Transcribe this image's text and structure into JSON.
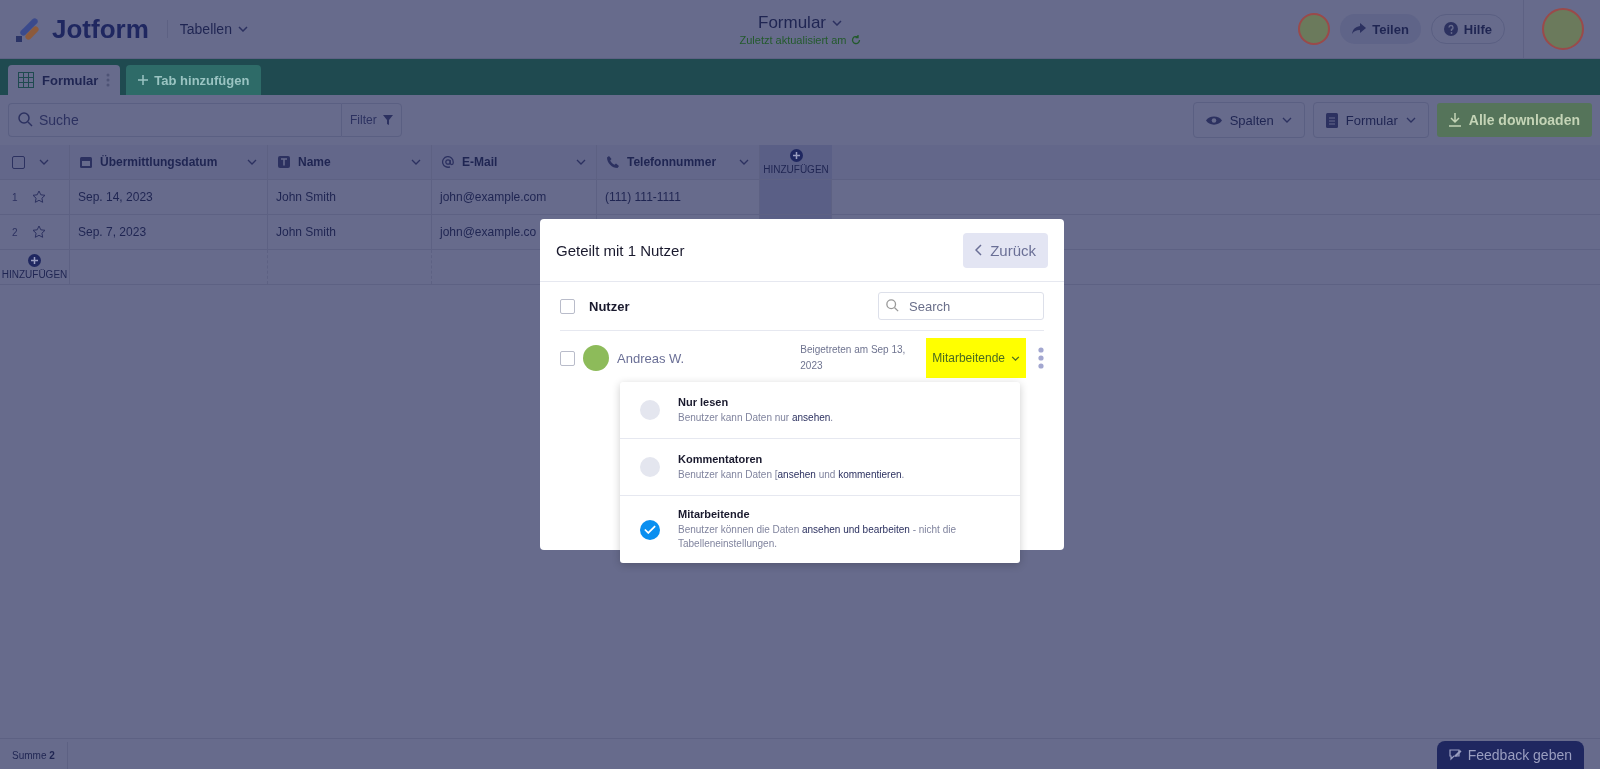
{
  "header": {
    "logo": "Jotform",
    "section": "Tabellen",
    "title": "Formular",
    "subtitle": "Zuletzt aktualisiert am",
    "share": "Teilen",
    "help": "Hilfe"
  },
  "tabs": [
    {
      "label": "Formular",
      "selected": true
    }
  ],
  "add_tab": "Tab hinzufügen",
  "toolbar": {
    "search_placeholder": "Suche",
    "filter": "Filter",
    "columns": "Spalten",
    "form": "Formular",
    "download": "Alle downloaden"
  },
  "table": {
    "select_all_checked": false,
    "columns": [
      {
        "kind": "date",
        "label": "Übermittlungsdatum"
      },
      {
        "kind": "text",
        "label": "Name"
      },
      {
        "kind": "email",
        "label": "E-Mail"
      },
      {
        "kind": "phone",
        "label": "Telefonnummer"
      }
    ],
    "add_column": "HINZUFÜGEN",
    "add_row": "HINZUFÜGEN",
    "rows": [
      {
        "index": "1",
        "cells": [
          "Sep. 14, 2023",
          "John Smith",
          "john@example.com",
          "(111) 111-1111"
        ]
      },
      {
        "index": "2",
        "cells": [
          "Sep. 7, 2023",
          "John Smith",
          "john@example.co"
        ]
      }
    ]
  },
  "footer": {
    "sum_label": "Summe",
    "sum": "2",
    "feedback": "Feedback geben"
  },
  "modal": {
    "title": "Geteilt mit 1 Nutzer",
    "back": "Zurück",
    "users_label": "Nutzer",
    "select_all_checked": false,
    "search_placeholder": "Search",
    "users": [
      {
        "name": "Andreas W.",
        "joined": "Beigetreten am Sep 13, 2023",
        "role": "Mitarbeitende",
        "checked": false
      }
    ],
    "roles": [
      {
        "title": "Nur lesen",
        "description": "Benutzer kann Daten nur **ansehen**.",
        "selected": false
      },
      {
        "title": "Kommentatoren",
        "description": "Benutzer kann Daten [**ansehen** und **kommentieren**.",
        "selected": false
      },
      {
        "title": "Mitarbeitende",
        "description": "Benutzer können die Daten **ansehen und bearbeiten** - nicht die Tabelleneinstellungen.",
        "selected": true
      }
    ]
  }
}
